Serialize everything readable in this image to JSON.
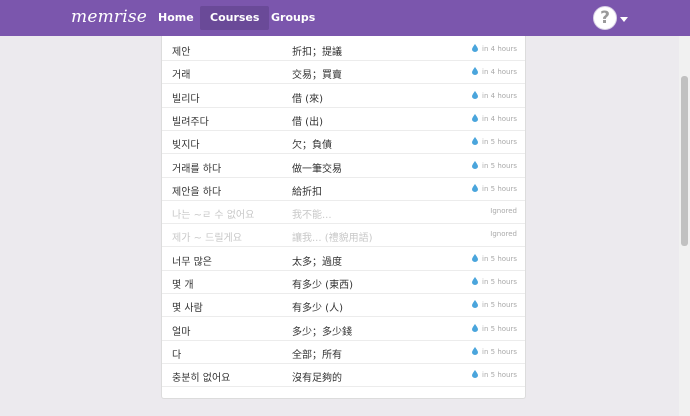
{
  "header": {
    "logo": "memrise",
    "nav": [
      {
        "label": "Home"
      },
      {
        "label": "Courses"
      },
      {
        "label": "Groups"
      }
    ],
    "avatar_glyph": "?"
  },
  "colors": {
    "topbar": "#7b56ad",
    "active_nav": "#6a4a98",
    "drop": "#4aa5dc"
  },
  "words": [
    {
      "korean": "제안",
      "chinese": "折扣；提議",
      "status": "in 4 hours",
      "ignored": false
    },
    {
      "korean": "거래",
      "chinese": "交易；買賣",
      "status": "in 4 hours",
      "ignored": false
    },
    {
      "korean": "빌리다",
      "chinese": "借 (來)",
      "status": "in 4 hours",
      "ignored": false
    },
    {
      "korean": "빌려주다",
      "chinese": "借 (出)",
      "status": "in 4 hours",
      "ignored": false
    },
    {
      "korean": "빚지다",
      "chinese": "欠；負債",
      "status": "in 5 hours",
      "ignored": false
    },
    {
      "korean": "거래를 하다",
      "chinese": "做一筆交易",
      "status": "in 5 hours",
      "ignored": false
    },
    {
      "korean": "제안을 하다",
      "chinese": "給折扣",
      "status": "in 5 hours",
      "ignored": false
    },
    {
      "korean": "나는 ~ㄹ 수 없어요",
      "chinese": "我不能...",
      "status": "Ignored",
      "ignored": true
    },
    {
      "korean": "제가 ~ 드릴게요",
      "chinese": "讓我... (禮貌用語)",
      "status": "Ignored",
      "ignored": true
    },
    {
      "korean": "너무 많은",
      "chinese": "太多；過度",
      "status": "in 5 hours",
      "ignored": false
    },
    {
      "korean": "몇 개",
      "chinese": "有多少 (東西)",
      "status": "in 5 hours",
      "ignored": false
    },
    {
      "korean": "몇 사람",
      "chinese": "有多少 (人)",
      "status": "in 5 hours",
      "ignored": false
    },
    {
      "korean": "얼마",
      "chinese": "多少；多少錢",
      "status": "in 5 hours",
      "ignored": false
    },
    {
      "korean": "다",
      "chinese": "全部；所有",
      "status": "in 5 hours",
      "ignored": false
    },
    {
      "korean": "충분히 없어요",
      "chinese": "沒有足夠的",
      "status": "in 5 hours",
      "ignored": false
    }
  ]
}
